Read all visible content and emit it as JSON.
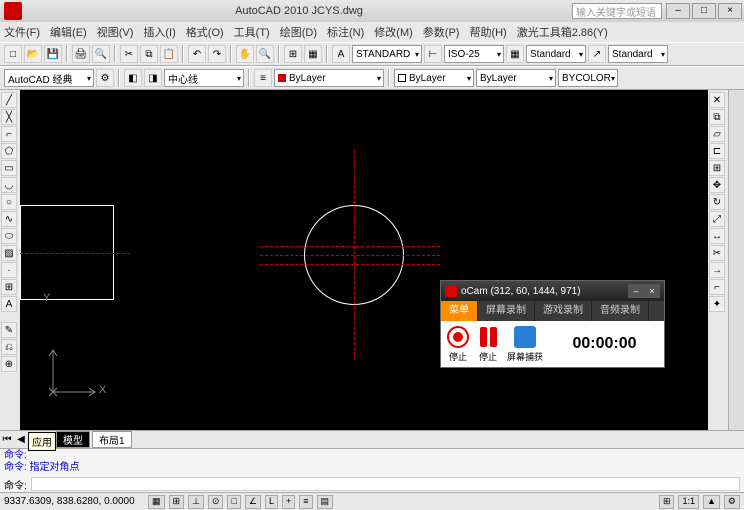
{
  "app": {
    "title": "AutoCAD 2010    JCYS.dwg",
    "searchPlaceholder": "输入关键字或短语"
  },
  "menu": [
    "文件(F)",
    "编辑(E)",
    "视图(V)",
    "插入(I)",
    "格式(O)",
    "工具(T)",
    "绘图(D)",
    "标注(N)",
    "修改(M)",
    "参数(P)",
    "帮助(H)",
    "激光工具箱2.86(Y)"
  ],
  "toolbar2": {
    "workspace": "AutoCAD 经典",
    "linetype": "中心线",
    "textStyle": "STANDARD",
    "dimStyle": "ISO-25",
    "tableStyle": "Standard",
    "mleaderStyle": "Standard"
  },
  "toolbar3": {
    "layer": "ByLayer",
    "color": "ByLayer",
    "lineweight": "ByLayer",
    "plotStyle": "BYCOLOR"
  },
  "ocam": {
    "title": "oCam (312, 60, 1444, 971)",
    "tabs": [
      "菜单",
      "屏幕录制",
      "游戏录制",
      "音频录制"
    ],
    "btns": {
      "stop": "停止",
      "pause": "停止",
      "capture": "屏幕捕获"
    },
    "timer": "00:00:00"
  },
  "ucs": {
    "x": "X",
    "y": "Y"
  },
  "modelTabs": {
    "model": "模型",
    "layout1": "布局1"
  },
  "cmd": {
    "line1": "命令:",
    "line2": "命令: 指定对角点",
    "prompt": "命令:"
  },
  "status": {
    "coords": "9337.6309, 838.6280, 0.0000",
    "scale": "1:1",
    "anno": "注释"
  },
  "tooltip": "应用"
}
